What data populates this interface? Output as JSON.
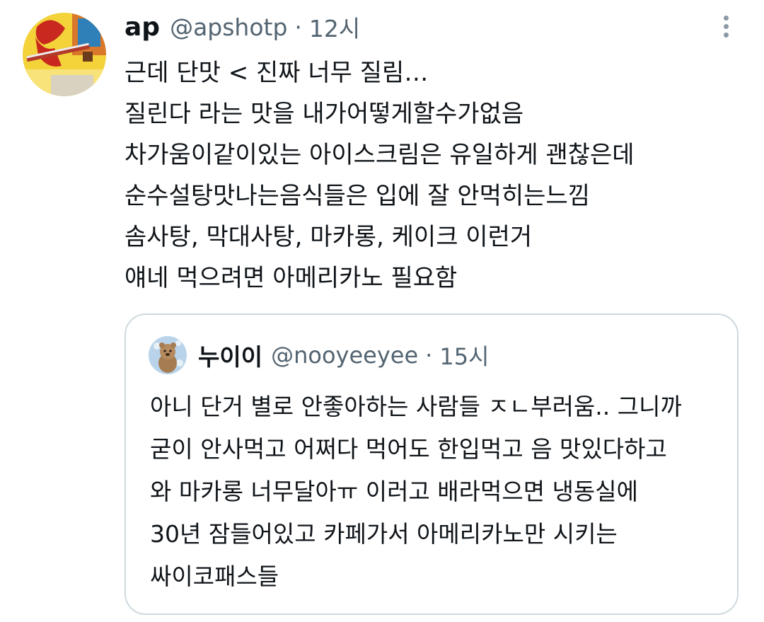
{
  "tweet": {
    "display_name": "ap",
    "handle": "@apshotp",
    "separator": "·",
    "time": "12시",
    "lines": [
      "근데 단맛 < 진짜 너무 질림…",
      "질린다 라는 맛을 내가어떻게할수가없음",
      "차가움이같이있는 아이스크림은 유일하게 괜찮은데",
      "순수설탕맛나는음식들은 입에 잘 안먹히는느낌",
      "솜사탕, 막대사탕, 마카롱, 케이크 이런거",
      "얘네 먹으려면 아메리카노 필요함"
    ],
    "more_icon": "more-vertical-icon"
  },
  "quote": {
    "display_name": "누이이",
    "handle": "@nooyeeyee",
    "separator": "·",
    "time": "15시",
    "lines": [
      "아니 단거 별로 안좋아하는 사람들 ㅈㄴ부러움.. 그니까",
      "굳이 안사먹고 어쩌다 먹어도 한입먹고 음 맛있다하고",
      "와 마카롱 너무달아ㅠ 이러고 배라먹으면 냉동실에",
      "30년 잠들어있고 카페가서 아메리카노만 시키는",
      "싸이코패스들"
    ]
  },
  "colors": {
    "text_primary": "#0f1419",
    "text_secondary": "#536471",
    "border": "#cfd9de"
  }
}
